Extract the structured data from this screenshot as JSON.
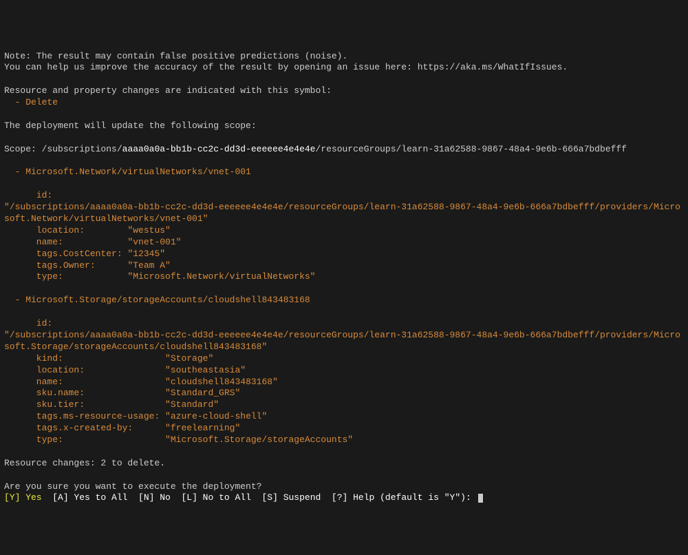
{
  "note_line1": "Note: The result may contain false positive predictions (noise).",
  "note_line2": "You can help us improve the accuracy of the result by opening an issue here: https://aka.ms/WhatIfIssues.",
  "changes_intro": "Resource and property changes are indicated with this symbol:",
  "delete_symbol": "  - Delete",
  "scope_intro": "The deployment will update the following scope:",
  "scope_prefix": "Scope: /subscriptions/",
  "subscription_id": "aaaa0a0a-bb1b-cc2c-dd3d-eeeeee4e4e4e",
  "scope_rg": "/resourceGroups/learn-31a62588-9867-48a4-9e6b-666a7bdbefff",
  "res1_header": "  - Microsoft.Network/virtualNetworks/vnet-001",
  "res1_id_label": "      id:",
  "res1_id_value": "\"/subscriptions/aaaa0a0a-bb1b-cc2c-dd3d-eeeeee4e4e4e/resourceGroups/learn-31a62588-9867-48a4-9e6b-666a7bdbefff/providers/Microsoft.Network/virtualNetworks/vnet-001\"",
  "res1_props": [
    {
      "k": "      location:        ",
      "v": "\"westus\""
    },
    {
      "k": "      name:            ",
      "v": "\"vnet-001\""
    },
    {
      "k": "      tags.CostCenter: ",
      "v": "\"12345\""
    },
    {
      "k": "      tags.Owner:      ",
      "v": "\"Team A\""
    },
    {
      "k": "      type:            ",
      "v": "\"Microsoft.Network/virtualNetworks\""
    }
  ],
  "res2_header": "  - Microsoft.Storage/storageAccounts/cloudshell843483168",
  "res2_id_label": "      id:",
  "res2_id_value": "\"/subscriptions/aaaa0a0a-bb1b-cc2c-dd3d-eeeeee4e4e4e/resourceGroups/learn-31a62588-9867-48a4-9e6b-666a7bdbefff/providers/Microsoft.Storage/storageAccounts/cloudshell843483168\"",
  "res2_props": [
    {
      "k": "      kind:                   ",
      "v": "\"Storage\""
    },
    {
      "k": "      location:               ",
      "v": "\"southeastasia\""
    },
    {
      "k": "      name:                   ",
      "v": "\"cloudshell843483168\""
    },
    {
      "k": "      sku.name:               ",
      "v": "\"Standard_GRS\""
    },
    {
      "k": "      sku.tier:               ",
      "v": "\"Standard\""
    },
    {
      "k": "      tags.ms-resource-usage: ",
      "v": "\"azure-cloud-shell\""
    },
    {
      "k": "      tags.x-created-by:      ",
      "v": "\"freelearning\""
    },
    {
      "k": "      type:                   ",
      "v": "\"Microsoft.Storage/storageAccounts\""
    }
  ],
  "summary": "Resource changes: 2 to delete.",
  "confirm_question": "Are you sure you want to execute the deployment?",
  "prompt": {
    "y_key": "[Y] Yes",
    "a_key": "  [A] Yes to All",
    "n_key": "  [N] No",
    "l_key": "  [L] No to All",
    "s_key": "  [S] Suspend",
    "help_key": "  [?] Help (default is \"Y\"): "
  }
}
